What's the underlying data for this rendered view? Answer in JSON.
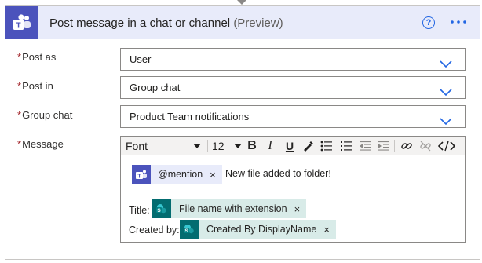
{
  "header": {
    "title": "Post message in a chat or channel",
    "preview": "(Preview)",
    "help_icon": "question-circle-icon",
    "more_icon": "ellipsis-icon"
  },
  "fields": [
    {
      "label": "Post as",
      "value": "User",
      "required": true
    },
    {
      "label": "Post in",
      "value": "Group chat",
      "required": true
    },
    {
      "label": "Group chat",
      "value": "Product Team notifications",
      "required": true
    }
  ],
  "message": {
    "label": "Message",
    "required": true,
    "toolbar": {
      "font": "Font",
      "size": "12",
      "buttons": [
        "bold-icon",
        "italic-icon",
        "underline-icon",
        "pen-icon",
        "bullet-list-icon",
        "numbered-list-icon",
        "outdent-icon",
        "indent-icon",
        "link-icon",
        "unlink-icon",
        "code-icon"
      ]
    },
    "mention_token": "@mention",
    "line1_text": "New file added to folder!",
    "title_label": "Title:",
    "title_token": "File name with extension",
    "created_label": "Created by:",
    "created_token": "Created By DisplayName",
    "remove_glyph": "×"
  },
  "colors": {
    "accent": "#2266e3",
    "teams": "#4b53bc",
    "header_bg": "#e8ebfa",
    "sharepoint": "#036c70",
    "token_bg": "#d8ebe8",
    "required": "#a4262c"
  }
}
